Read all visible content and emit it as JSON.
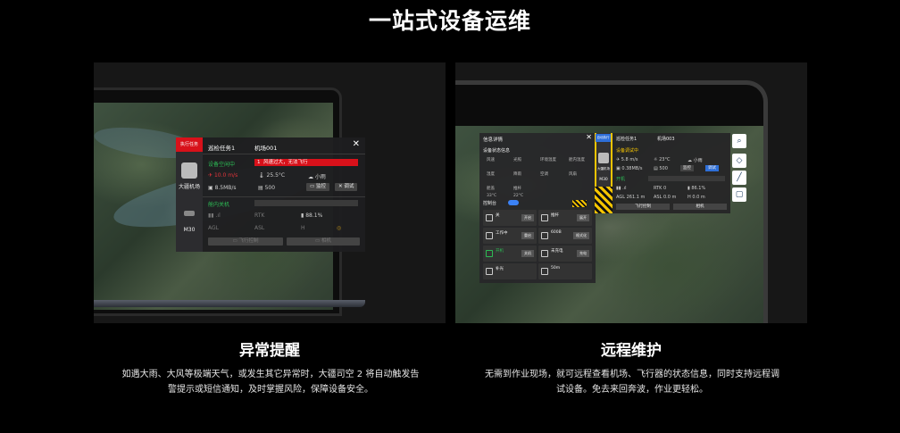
{
  "page": {
    "title": "一站式设备运维"
  },
  "left": {
    "title": "异常提醒",
    "description": "如遇大雨、大风等极端天气，或发生其它异常时，大疆司空 2 将自动触发告警提示或短信通知，及时掌握风险，保障设备安全。",
    "dialog": {
      "tab": "执行任务",
      "task": "巡检任务1",
      "dock_name": "机场001",
      "dock_label": "大疆机场",
      "drone_label": "M30",
      "status": "设备空闲中",
      "alert_num": "1",
      "alert_text": "风速过大，无法飞行",
      "wind": "10.0 m/s",
      "temp": "25.5°C",
      "weather": "小雨",
      "network": "8.5MB/s",
      "storage": "500",
      "monitor_btn": "监控",
      "debug_btn": "调试",
      "drone_status": "舱内关机",
      "rtk": "RTK",
      "battery": "88.1%",
      "agl": "AGL",
      "asl": "ASL",
      "h": "H",
      "fly_btn": "飞行控制",
      "camera_btn": "相机"
    }
  },
  "right": {
    "title": "远程维护",
    "description": "无需到作业现场，就可远程查看机场、飞行器的状态信息，同时支持远程调试设备。免去来回奔波，作业更轻松。",
    "card1": {
      "title": "信息详情",
      "section": "设备状态信息",
      "cells": [
        "风速",
        "光照",
        "环境温度",
        "舱内温度",
        "湿度",
        "降雨",
        "空调",
        "风扇",
        "舱盖",
        "推杆",
        "33°C",
        "22°C"
      ],
      "control_title": "控制台",
      "tiles": [
        {
          "label": "关",
          "btn": "开启"
        },
        {
          "label": "推杆",
          "btn": "展开"
        },
        {
          "label": "工作中",
          "btn": "重启"
        },
        {
          "label": "600B",
          "btn": "格式化"
        },
        {
          "label": "开机",
          "btn": "关机"
        },
        {
          "label": "未充电",
          "btn": "充电"
        },
        {
          "label": "补光",
          "btn": ""
        },
        {
          "label": "50m",
          "btn": ""
        }
      ]
    },
    "card2": {
      "task": "巡检任务1",
      "dock": "机场003",
      "dock_label": "大疆机场",
      "drone_label": "M30",
      "badge": "自动执行",
      "status": "设备调试中",
      "wind": "5.8 m/s",
      "temp": "23°C",
      "weather": "小雨",
      "network": "0.38MB/s",
      "storage": "500",
      "monitor_btn": "监控",
      "debug_btn": "调试",
      "drone_status": "开机",
      "rtk": "RTK 0",
      "battery": "86.1%",
      "agl": "AGL 261.1 m",
      "asl": "ASL 0.0 m",
      "h": "H 0.0 m",
      "fly_btn": "飞行控制",
      "camera_btn": "相机"
    }
  },
  "colors": {
    "alert_red": "#d8111a",
    "status_green": "#2dbb55",
    "accent_blue": "#2e6fd8",
    "warning_yellow": "#f5c400"
  }
}
